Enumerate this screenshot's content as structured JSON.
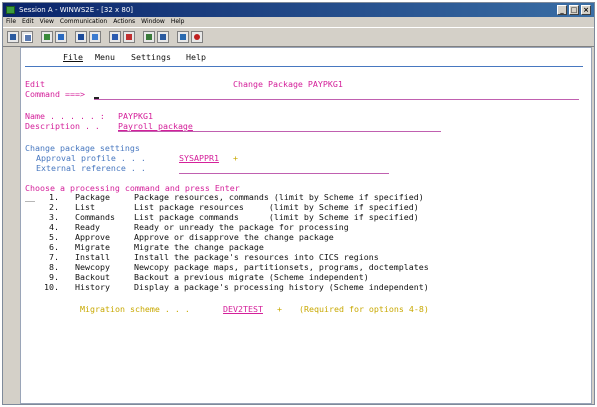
{
  "window": {
    "title": "Session A - WINWS2E - [32 x 80]",
    "controls": {
      "minimize": "_",
      "maximize": "□",
      "close": "×"
    }
  },
  "menubar": [
    "File",
    "Edit",
    "View",
    "Communication",
    "Actions",
    "Window",
    "Help"
  ],
  "toolbar_icons": [
    "print-screen-icon",
    "copy-icon",
    "paste-icon",
    "send-icon",
    "receive-icon",
    "record-icon",
    "stop-icon",
    "play-icon",
    "chart-icon",
    "keyboard-icon",
    "color-palette-icon",
    "help-icon"
  ],
  "ispf_menu": {
    "file": "File",
    "menu": "Menu",
    "settings": "Settings",
    "help": "Help"
  },
  "panel": {
    "left_title": "Edit",
    "title": "Change Package PAYPKG1",
    "command_label": "Command ===>"
  },
  "fields": {
    "name_label": "Name . . . . . :",
    "name_value": "PAYPKG1",
    "description_label": "Description . .",
    "description_value": "Payroll package"
  },
  "settings": {
    "heading": "Change package settings",
    "approval_label": "Approval profile . . .",
    "approval_value": "SYSAPPR1",
    "approval_marker": "+",
    "external_label": "External reference . ."
  },
  "commands": {
    "heading": "Choose a processing command and press Enter",
    "selection_field": "__",
    "items": [
      {
        "num": "1.",
        "name": "Package",
        "desc": "Package resources, commands (limit by Scheme if specified)"
      },
      {
        "num": "2.",
        "name": "List",
        "desc": "List package resources     (limit by Scheme if specified)"
      },
      {
        "num": "3.",
        "name": "Commands",
        "desc": "List package commands      (limit by Scheme if specified)"
      },
      {
        "num": "4.",
        "name": "Ready",
        "desc": "Ready or unready the package for processing"
      },
      {
        "num": "5.",
        "name": "Approve",
        "desc": "Approve or disapprove the change package"
      },
      {
        "num": "6.",
        "name": "Migrate",
        "desc": "Migrate the change package"
      },
      {
        "num": "7.",
        "name": "Install",
        "desc": "Install the package's resources into CICS regions"
      },
      {
        "num": "8.",
        "name": "Newcopy",
        "desc": "Newcopy package maps, partitionsets, programs, doctemplates"
      },
      {
        "num": "9.",
        "name": "Backout",
        "desc": "Backout a previous migrate (Scheme independent)"
      },
      {
        "num": "10.",
        "name": "History",
        "desc": "Display a package's processing history (Scheme independent)"
      }
    ]
  },
  "migration": {
    "label": "Migration scheme . . .",
    "value": "DEV2TEST",
    "marker": "+",
    "note": "(Required for options 4-8)"
  },
  "colors": {
    "titlebar": "#0a246a",
    "pink": "#d4209a",
    "blue": "#4878c0",
    "yellow": "#c8a800",
    "red": "#c82020"
  }
}
